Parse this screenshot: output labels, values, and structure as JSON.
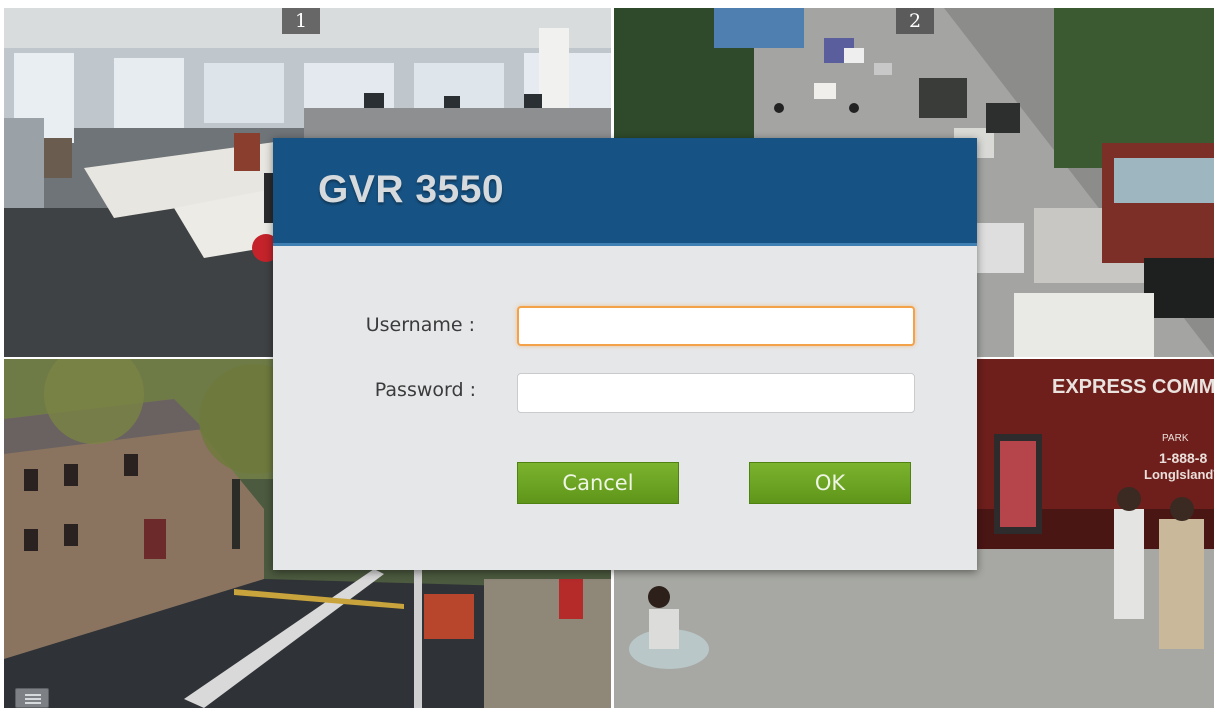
{
  "dialog": {
    "title": "GVR 3550",
    "username_label": "Username :",
    "username_value": "",
    "password_label": "Password :",
    "password_value": "",
    "cancel_label": "Cancel",
    "ok_label": "OK"
  },
  "cameras": [
    {
      "number": "1",
      "scene": "office"
    },
    {
      "number": "2",
      "scene": "street-traffic"
    },
    {
      "number": "",
      "scene": "street-corner"
    },
    {
      "number": "",
      "scene": "sidewalk-bus-stop"
    }
  ],
  "overlay_text": {
    "bus_sign": "EXPRESS COMMU",
    "bus_phone": "1-888-8",
    "bus_brand": "LongIslandTr",
    "bus_park": "PARK"
  },
  "colors": {
    "header": "#165283",
    "accent_focus": "#f3a24a",
    "button_green": "#6aa324",
    "dialog_bg": "#e6e7e9"
  },
  "icons": {
    "menu": "menu-icon"
  }
}
